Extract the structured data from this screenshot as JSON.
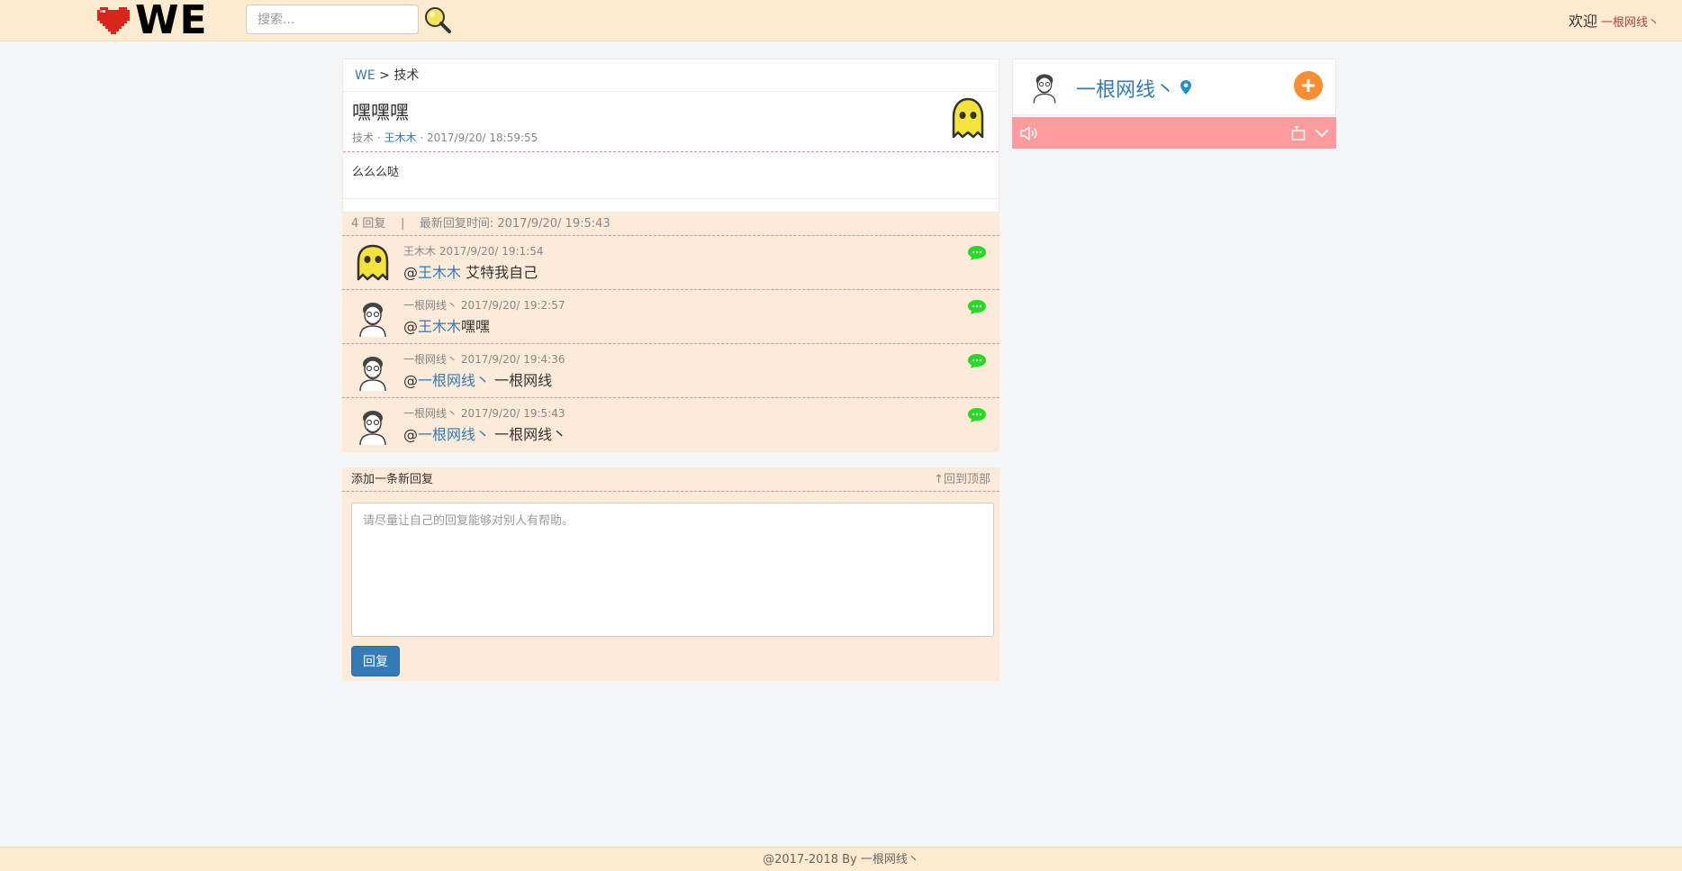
{
  "header": {
    "logo_text": "WE",
    "search_placeholder": "搜索...",
    "welcome_label": "欢迎",
    "username": "一根网线丶"
  },
  "breadcrumb": {
    "home": "WE",
    "separator": ">",
    "current": "技术"
  },
  "post": {
    "title": "嘿嘿嘿",
    "category": "技术",
    "dot1": "·",
    "author": "王木木",
    "dot2": "·",
    "datetime": "2017/9/20/ 18:59:55",
    "body": "么么么哒"
  },
  "replies_summary": {
    "count_text": "4 回复",
    "divider": "|",
    "latest_label": "最新回复时间:",
    "latest_time": "2017/9/20/ 19:5:43"
  },
  "replies": [
    {
      "user": "王木木",
      "time": "2017/9/20/ 19:1:54",
      "at": "@",
      "mention": "王木木",
      "text": " 艾特我自己",
      "avatar": "ghost-avatar-icon"
    },
    {
      "user": "一根网线丶",
      "time": "2017/9/20/ 19:2:57",
      "at": "@",
      "mention": "王木木",
      "text": "嘿嘿",
      "avatar": "man-avatar-icon"
    },
    {
      "user": "一根网线丶",
      "time": "2017/9/20/ 19:4:36",
      "at": "@",
      "mention": "一根网线丶",
      "text": " 一根网线",
      "avatar": "man-avatar-icon"
    },
    {
      "user": "一根网线丶",
      "time": "2017/9/20/ 19:5:43",
      "at": "@",
      "mention": "一根网线丶",
      "text": " 一根网线丶",
      "avatar": "man-avatar-icon"
    }
  ],
  "reply_form": {
    "title": "添加一条新回复",
    "back_to_top": "↑回到顶部",
    "placeholder": "请尽量让自己的回复能够对别人有帮助。",
    "submit_label": "回复"
  },
  "sidebar": {
    "profile_name": "一根网线丶"
  },
  "footer": {
    "text": "@2017-2018 By 一根网线丶"
  },
  "colors": {
    "header_bg": "#fdebd0",
    "link": "#337ab7",
    "reply_bg": "#fbebd8",
    "music_bar": "#ff9a9e",
    "add_button": "#fb8c2f",
    "chat_icon": "#22dd22"
  }
}
